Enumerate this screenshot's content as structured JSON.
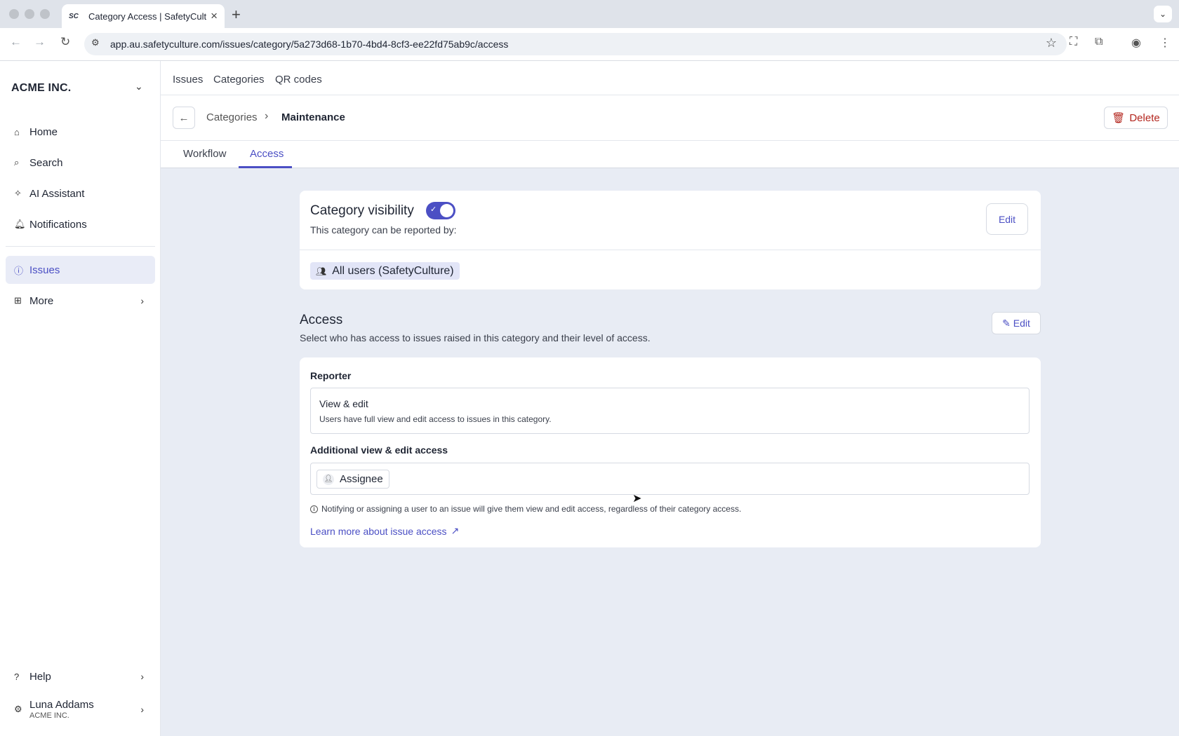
{
  "browser": {
    "tab_title": "Category Access | SafetyCult",
    "favicon": "SC",
    "url": "app.au.safetyculture.com/issues/category/5a273d68-1b70-4bd4-8cf3-ee22fd75ab9c/access"
  },
  "sidebar": {
    "org": "ACME INC.",
    "items": [
      {
        "label": "Home",
        "icon": "home-icon"
      },
      {
        "label": "Search",
        "icon": "search-icon"
      },
      {
        "label": "AI Assistant",
        "icon": "ai-icon"
      },
      {
        "label": "Notifications",
        "icon": "bell-icon"
      },
      {
        "label": "Issues",
        "icon": "issues-icon",
        "active": true
      },
      {
        "label": "More",
        "icon": "grid-icon"
      }
    ],
    "help": "Help",
    "user": {
      "name": "Luna Addams",
      "org": "ACME INC."
    }
  },
  "topnav": [
    "Issues",
    "Categories",
    "QR codes"
  ],
  "breadcrumb": {
    "parent": "Categories",
    "current": "Maintenance"
  },
  "delete_label": "Delete",
  "tabs": {
    "workflow": "Workflow",
    "access": "Access",
    "active": "access"
  },
  "visibility": {
    "title": "Category visibility",
    "enabled": true,
    "subtitle": "This category can be reported by:",
    "group": "All users (SafetyCulture)",
    "edit_label": "Edit"
  },
  "access": {
    "title": "Access",
    "subtitle": "Select who has access to issues raised in this category and their level of access.",
    "edit_label": "Edit",
    "reporter_label": "Reporter",
    "reporter_level": "View & edit",
    "reporter_desc": "Users have full view and edit access to issues in this category.",
    "additional_label": "Additional view & edit access",
    "additional_chip": "Assignee",
    "note": "Notifying or assigning a user to an issue will give them view and edit access, regardless of their category access.",
    "learn_more": "Learn more about issue access"
  },
  "colors": {
    "accent": "#4b4fc4",
    "danger": "#b3261e",
    "background": "#e8ecf4"
  }
}
